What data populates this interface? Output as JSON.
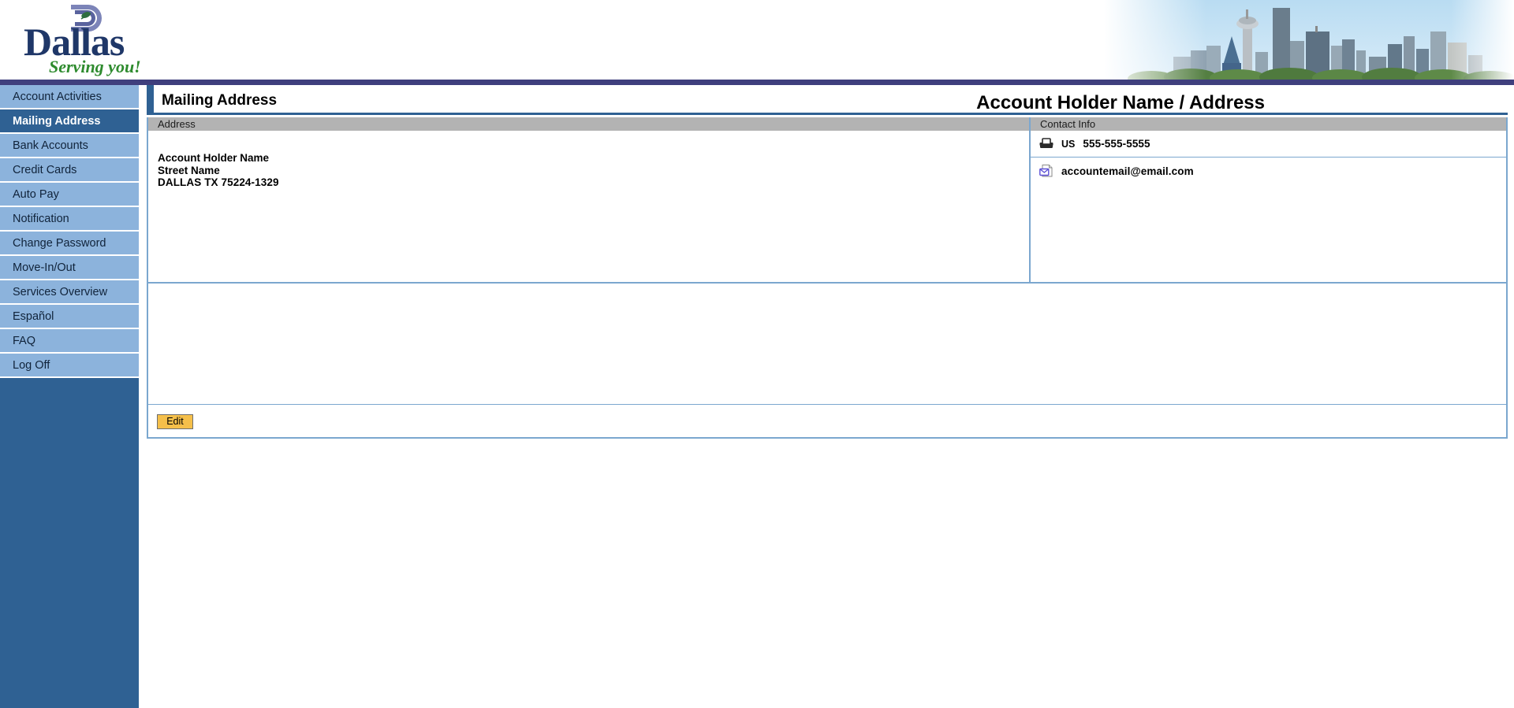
{
  "brand": {
    "name": "Dallas",
    "tagline": "Serving you!",
    "logo_icon": "dallas-d-leaf-logo",
    "skyline_icon": "dallas-skyline-photo"
  },
  "sidebar": {
    "items": [
      {
        "label": "Account Activities",
        "active": false
      },
      {
        "label": "Mailing Address",
        "active": true
      },
      {
        "label": "Bank Accounts",
        "active": false
      },
      {
        "label": "Credit Cards",
        "active": false
      },
      {
        "label": "Auto Pay",
        "active": false
      },
      {
        "label": "Notification",
        "active": false
      },
      {
        "label": "Change Password",
        "active": false
      },
      {
        "label": "Move-In/Out",
        "active": false
      },
      {
        "label": "Services Overview",
        "active": false
      },
      {
        "label": "Español",
        "active": false
      },
      {
        "label": "FAQ",
        "active": false
      },
      {
        "label": "Log Off",
        "active": false
      }
    ]
  },
  "main": {
    "page_title": "Mailing Address",
    "account_heading": "Account Holder Name / Address",
    "address_column": {
      "header": "Address",
      "lines": [
        "Account Holder Name",
        "Street Name",
        "DALLAS TX 75224-1329"
      ]
    },
    "contact_column": {
      "header": "Contact Info",
      "rows": [
        {
          "icon": "phone-icon",
          "country": "US",
          "value": "555-555-5555"
        },
        {
          "icon": "email-icon",
          "country": "",
          "value": "accountemail@email.com"
        }
      ]
    },
    "actions": {
      "edit_label": "Edit"
    }
  },
  "colors": {
    "header_rule": "#3f3f7d",
    "sidebar_bg": "#2f6193",
    "nav_bg": "#8cb3dc",
    "nav_active_bg": "#2f6193",
    "panel_border": "#7ba7cf",
    "column_header_bg": "#b3b3b3",
    "edit_button_bg": "#f5bf4a",
    "brand_navy": "#1f3768",
    "brand_green": "#2e8b2e"
  }
}
